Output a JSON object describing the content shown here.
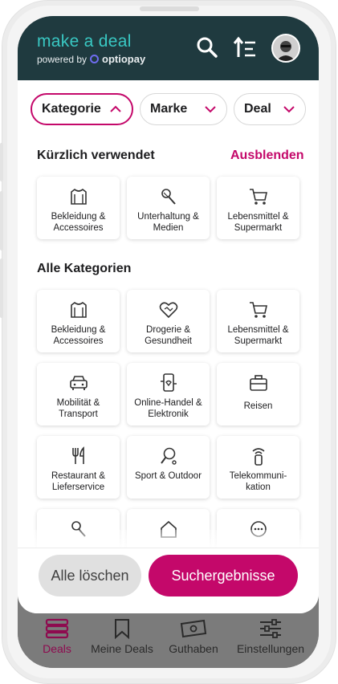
{
  "header": {
    "brand": "make a deal",
    "powered_by": "powered by",
    "partner": "optiopay",
    "icons": [
      "search-icon",
      "sort-icon",
      "avatar"
    ]
  },
  "filters": [
    {
      "label": "Kategorie",
      "state": "expanded",
      "active": true
    },
    {
      "label": "Marke",
      "state": "collapsed",
      "active": false
    },
    {
      "label": "Deal",
      "state": "collapsed",
      "active": false
    }
  ],
  "recent": {
    "title": "Kürzlich verwendet",
    "hide_label": "Ausblenden",
    "items": [
      {
        "label": "Bekleidung & Accessoires",
        "icon": "shirt-icon"
      },
      {
        "label": "Unterhaltung & Medien",
        "icon": "microphone-icon"
      },
      {
        "label": "Lebensmittel & Supermarkt",
        "icon": "cart-icon"
      }
    ]
  },
  "all": {
    "title": "Alle Kategorien",
    "items": [
      {
        "label": "Bekleidung & Accessoires",
        "icon": "shirt-icon"
      },
      {
        "label": "Drogerie & Gesundheit",
        "icon": "heart-icon"
      },
      {
        "label": "Lebensmittel & Supermarkt",
        "icon": "cart-icon"
      },
      {
        "label": "Mobilität & Transport",
        "icon": "car-icon"
      },
      {
        "label": "Online-Handel & Elektronik",
        "icon": "phone-icon"
      },
      {
        "label": "Reisen",
        "icon": "suitcase-icon"
      },
      {
        "label": "Restaurant & Lieferservice",
        "icon": "cutlery-icon"
      },
      {
        "label": "Sport & Outdoor",
        "icon": "racket-icon"
      },
      {
        "label": "Telekommuni-kation",
        "icon": "signal-icon"
      }
    ]
  },
  "actions": {
    "clear_label": "Alle löschen",
    "results_label": "Suchergebnisse"
  },
  "nav": [
    {
      "label": "Deals",
      "icon": "deals-icon",
      "active": true
    },
    {
      "label": "Meine Deals",
      "icon": "bookmark-icon",
      "active": false
    },
    {
      "label": "Guthaben",
      "icon": "cash-icon",
      "active": false
    },
    {
      "label": "Einstellungen",
      "icon": "sliders-icon",
      "active": false
    }
  ],
  "colors": {
    "accent": "#c4086a",
    "header_bg": "#1f3a3f",
    "brand": "#39c8c3",
    "partner_mark": "#6f6cf0",
    "nav_active": "#8e0a4f"
  }
}
